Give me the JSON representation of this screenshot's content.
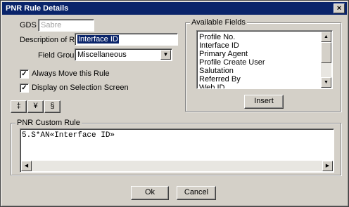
{
  "window": {
    "title": "PNR Rule Details",
    "close_glyph": "×"
  },
  "gds": {
    "label": "GDS",
    "value": "Sabre"
  },
  "description": {
    "label": "Description of Rule",
    "value": "Interface ID"
  },
  "field_groups": {
    "label": "Field Groups",
    "value": "Miscellaneous"
  },
  "always_move": {
    "label": "Always Move this Rule",
    "checked": true,
    "mark": "✓"
  },
  "display_on_selection": {
    "label": "Display on Selection Screen",
    "checked": true,
    "mark": "✓"
  },
  "symbols": {
    "dollar_a": "‡",
    "yen": "¥",
    "dollar_b": "§"
  },
  "available_fields": {
    "title": "Available Fields",
    "items": [
      "Profile No.",
      "Interface ID",
      "Primary Agent",
      "Profile Create User",
      "Salutation",
      "Referred By",
      "Web ID"
    ],
    "insert_label": "Insert"
  },
  "custom_rule": {
    "title": "PNR Custom Rule",
    "value": "5.S*AN«Interface ID»"
  },
  "buttons": {
    "ok": "Ok",
    "cancel": "Cancel"
  }
}
